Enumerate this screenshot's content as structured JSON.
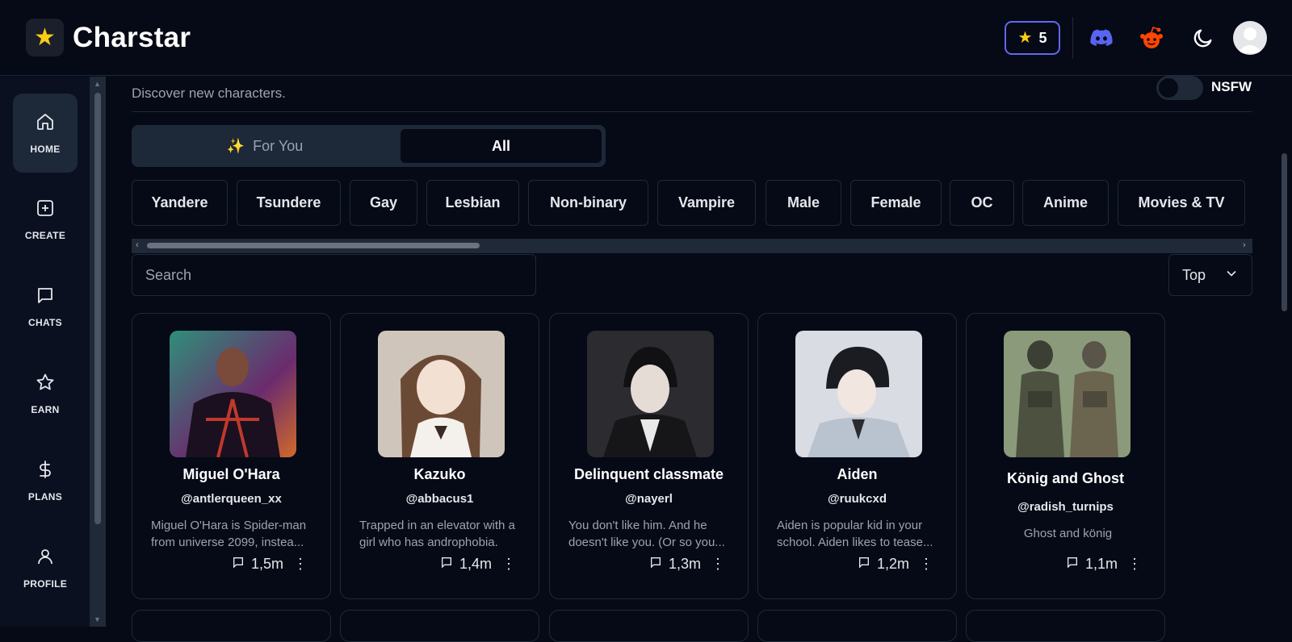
{
  "header": {
    "app_name": "Charstar",
    "logo_icon": "star-icon",
    "credits": "5",
    "icons": [
      "discord-icon",
      "reddit-icon",
      "moon-icon",
      "avatar"
    ]
  },
  "sidebar": {
    "items": [
      {
        "label": "HOME",
        "icon": "home-icon"
      },
      {
        "label": "CREATE",
        "icon": "plus-square-icon"
      },
      {
        "label": "CHATS",
        "icon": "chat-icon"
      },
      {
        "label": "EARN",
        "icon": "star-outline-icon"
      },
      {
        "label": "PLANS",
        "icon": "dollar-icon"
      },
      {
        "label": "PROFILE",
        "icon": "user-icon"
      }
    ]
  },
  "main": {
    "subtitle": "Discover new characters.",
    "nsfw_label": "NSFW",
    "tabs": [
      {
        "label": "For You",
        "icon": "sparkles-icon"
      },
      {
        "label": "All"
      }
    ],
    "categories": [
      "Yandere",
      "Tsundere",
      "Gay",
      "Lesbian",
      "Non-binary",
      "Vampire",
      "Male",
      "Female",
      "OC",
      "Anime",
      "Movies & TV"
    ],
    "search_placeholder": "Search",
    "sort_value": "Top",
    "characters": [
      {
        "name": "Miguel O'Hara",
        "handle": "@antlerqueen_xx",
        "desc_1": "Miguel O'Hara is Spider-man",
        "desc_2": "from universe 2099, instea...",
        "chats": "1,5m"
      },
      {
        "name": "Kazuko",
        "handle": "@abbacus1",
        "desc_1": "Trapped in an elevator with a",
        "desc_2": "girl who has androphobia.",
        "chats": "1,4m"
      },
      {
        "name": "Delinquent classmate",
        "handle": "@nayerl",
        "desc_1": "You don't like him. And he",
        "desc_2": "doesn't like you. (Or so you...",
        "chats": "1,3m"
      },
      {
        "name": "Aiden",
        "handle": "@ruukcxd",
        "desc_1": "Aiden is popular kid in your",
        "desc_2": "school. Aiden likes to tease...",
        "chats": "1,2m"
      },
      {
        "name": "König and Ghost",
        "handle": "@radish_turnips",
        "desc_1": "Ghost and könig",
        "desc_2": "",
        "chats": "1,1m"
      }
    ]
  },
  "colors": {
    "background": "#050a16",
    "accent": "#6366f1",
    "star": "#facc15",
    "discord": "#5865f2",
    "reddit": "#ff4500"
  }
}
